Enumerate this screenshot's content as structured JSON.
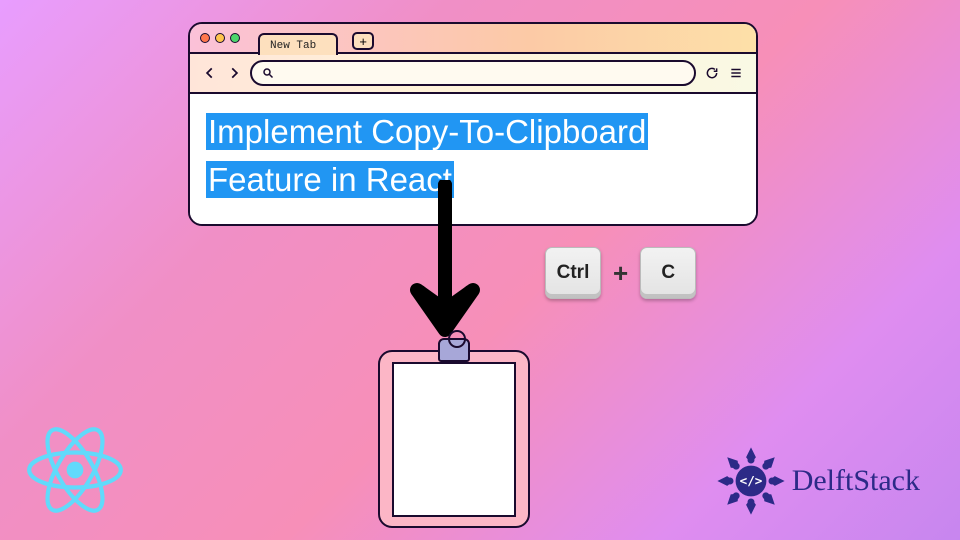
{
  "browser": {
    "tab_label": "New Tab",
    "new_tab_symbol": "+"
  },
  "content": {
    "selected_text": "Implement Copy-To-Clipboard Feature in React"
  },
  "shortcut": {
    "key1": "Ctrl",
    "plus": "+",
    "key2": "C"
  },
  "brand": {
    "name": "DelftStack"
  }
}
